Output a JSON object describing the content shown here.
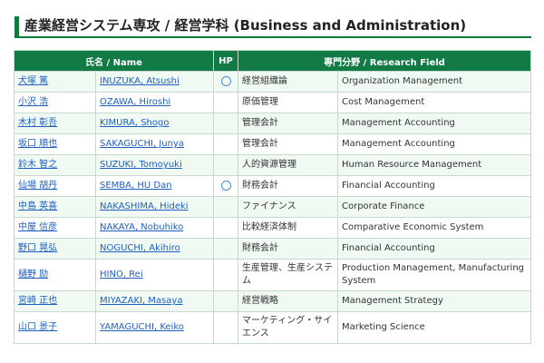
{
  "page_title": "産業経営システム専攻 / 経営学科 (Business and Administration)",
  "table": {
    "headers": {
      "name": "氏名 / Name",
      "hp": "HP",
      "field": "専門分野 / Research Field"
    },
    "rows": [
      {
        "name_ja": "犬塚 篤",
        "name_en": "INUZUKA, Atsushi",
        "hp": true,
        "field_ja": "経営組織論",
        "field_en": "Organization Management"
      },
      {
        "name_ja": "小沢 浩",
        "name_en": "OZAWA, Hiroshi",
        "hp": false,
        "field_ja": "原価管理",
        "field_en": "Cost Management"
      },
      {
        "name_ja": "木村 彰吾",
        "name_en": "KIMURA, Shogo",
        "hp": false,
        "field_ja": "管理会計",
        "field_en": "Management Accounting"
      },
      {
        "name_ja": "坂口 順也",
        "name_en": "SAKAGUCHI, Junya",
        "hp": false,
        "field_ja": "管理会計",
        "field_en": "Management Accounting"
      },
      {
        "name_ja": "鈴木 智之",
        "name_en": "SUZUKI, Tomoyuki",
        "hp": false,
        "field_ja": "人的資源管理",
        "field_en": "Human Resource Management"
      },
      {
        "name_ja": "仙場 胡丹",
        "name_en": "SEMBA, HU Dan",
        "hp": true,
        "field_ja": "財務会計",
        "field_en": "Financial Accounting"
      },
      {
        "name_ja": "中島 英喜",
        "name_en": "NAKASHIMA, Hideki",
        "hp": false,
        "field_ja": "ファイナンス",
        "field_en": "Corporate Finance"
      },
      {
        "name_ja": "中屋 信彦",
        "name_en": "NAKAYA, Nobuhiko",
        "hp": false,
        "field_ja": "比較経済体制",
        "field_en": "Comparative Economic System"
      },
      {
        "name_ja": "野口 晃弘",
        "name_en": "NOGUCHI, Akihiro",
        "hp": false,
        "field_ja": "財務会計",
        "field_en": "Financial Accounting"
      },
      {
        "name_ja": "樋野 励",
        "name_en": "HINO, Rei",
        "hp": false,
        "field_ja": "生産管理、生産システム",
        "field_en": "Production Management, Manufacturing System"
      },
      {
        "name_ja": "宮崎 正也",
        "name_en": "MIYAZAKI, Masaya",
        "hp": false,
        "field_ja": "経営戦略",
        "field_en": "Management Strategy"
      },
      {
        "name_ja": "山口 景子",
        "name_en": "YAMAGUCHI, Keiko",
        "hp": false,
        "field_ja": "マーケティング・サイエンス",
        "field_en": "Marketing Science"
      }
    ]
  },
  "colors": {
    "accent_green": "#117a45",
    "row_tint": "#f0faf3",
    "link_blue": "#1f5fbf"
  },
  "icons": {
    "hp": "circle-homepage-link-icon"
  }
}
